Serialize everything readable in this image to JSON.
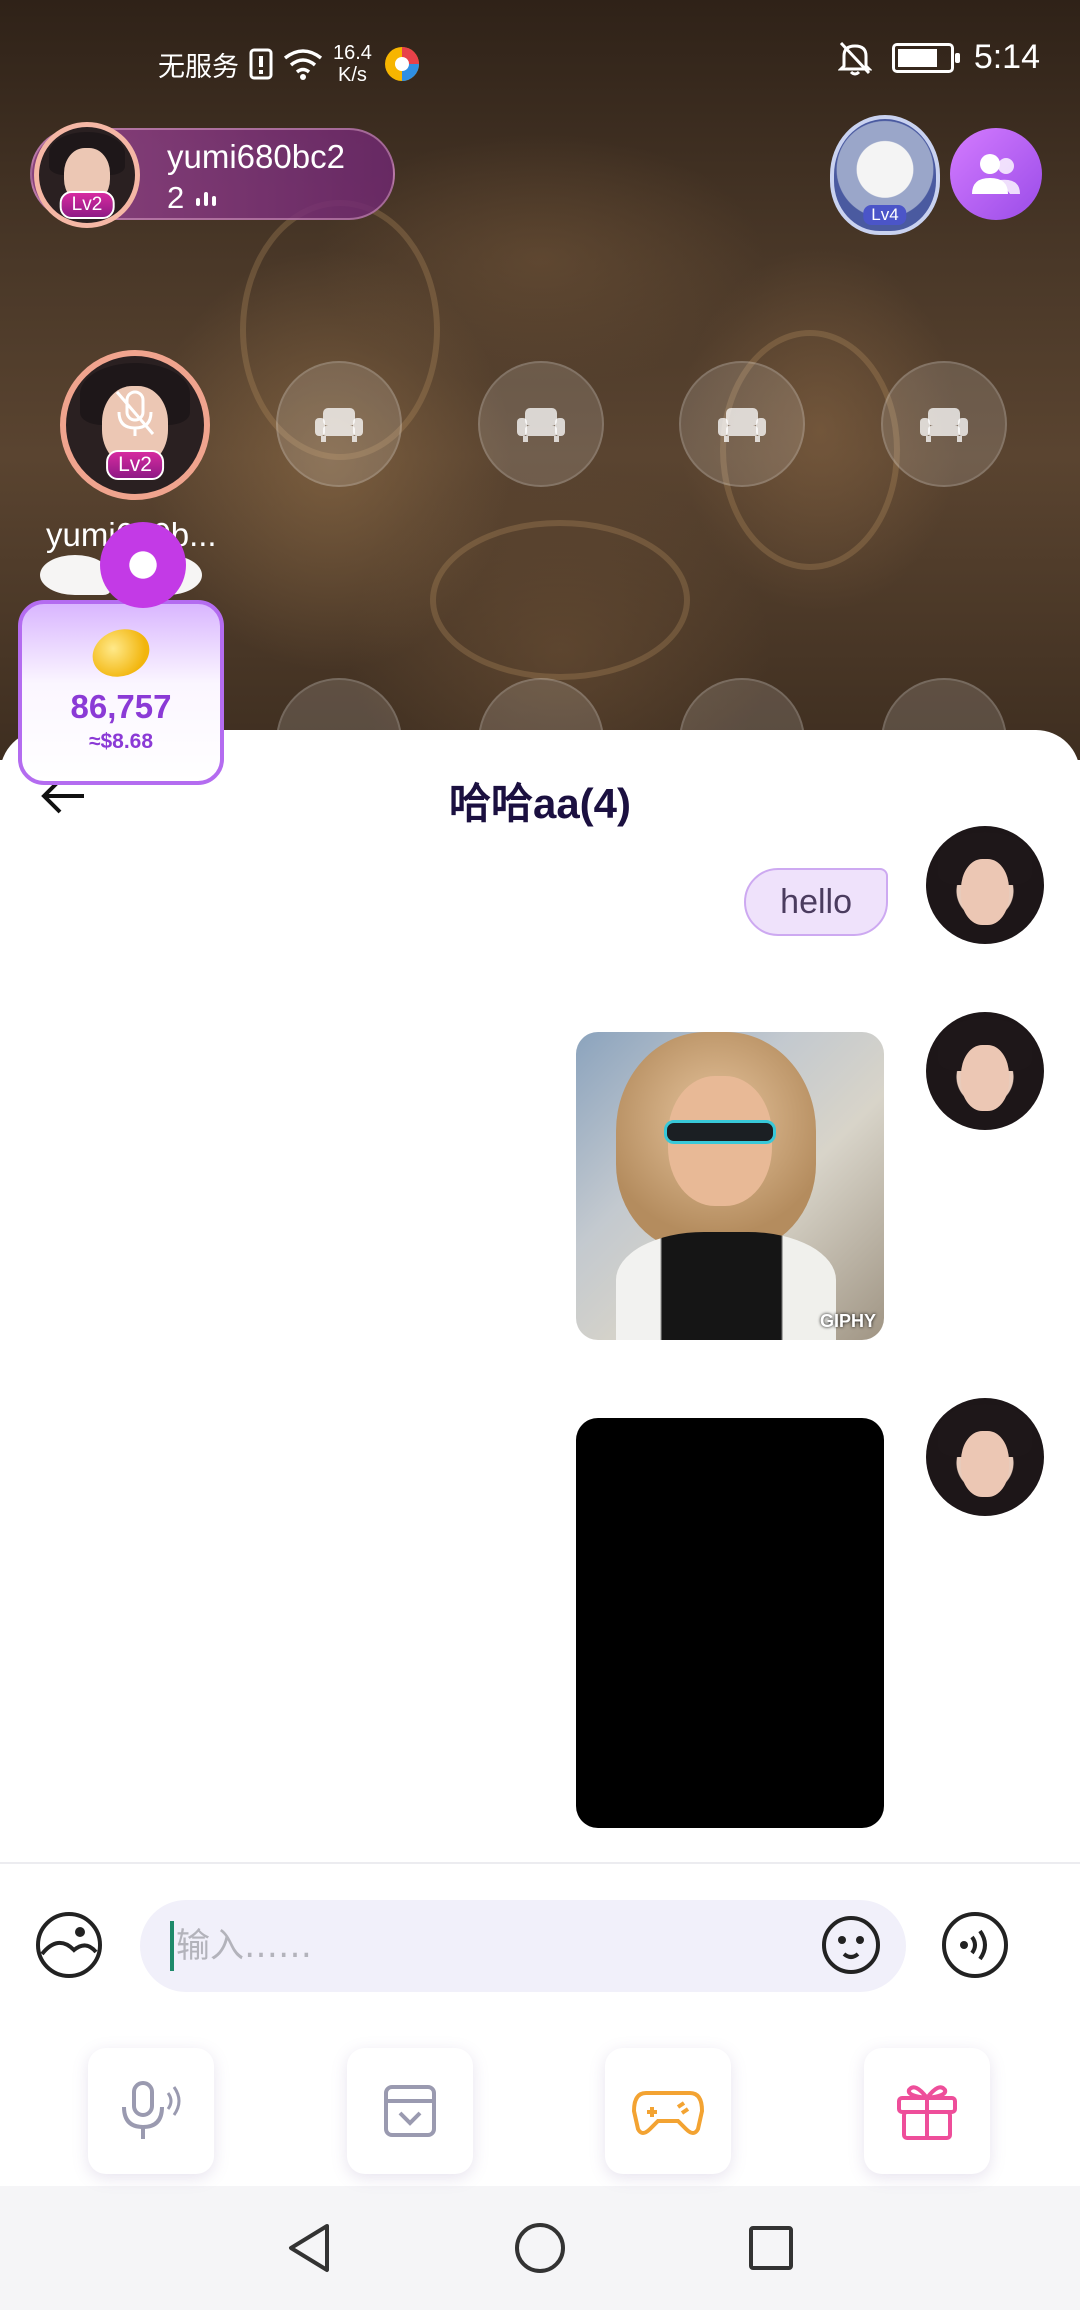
{
  "status_bar": {
    "carrier": "无服务",
    "net_speed_value": "16.4",
    "net_speed_unit": "K/s",
    "time": "5:14"
  },
  "host": {
    "name": "yumi680bc2",
    "count": "2",
    "level": "Lv2"
  },
  "room_badge": {
    "level": "Lv4"
  },
  "seat_main": {
    "name": "yumi680b...",
    "level": "Lv2"
  },
  "coin_widget": {
    "value": "86,757",
    "usd": "≈$8.68"
  },
  "chat": {
    "title": "哈哈aa(4)",
    "messages": [
      {
        "type": "text",
        "text": "hello"
      },
      {
        "type": "gif",
        "tag": "GIPHY"
      },
      {
        "type": "video"
      }
    ]
  },
  "input": {
    "placeholder": "输入……"
  },
  "colors": {
    "accent": "#9a4ce8",
    "bubble_bg": "#efe2fb",
    "title_text": "#1b1040",
    "coin_text": "#8b3ad6"
  },
  "icons": [
    "album-icon",
    "emoji-icon",
    "voice-wave-icon",
    "mic-icon",
    "bag-icon",
    "gamepad-icon",
    "gift-icon",
    "back-icon",
    "people-icon",
    "sofa-icon"
  ]
}
